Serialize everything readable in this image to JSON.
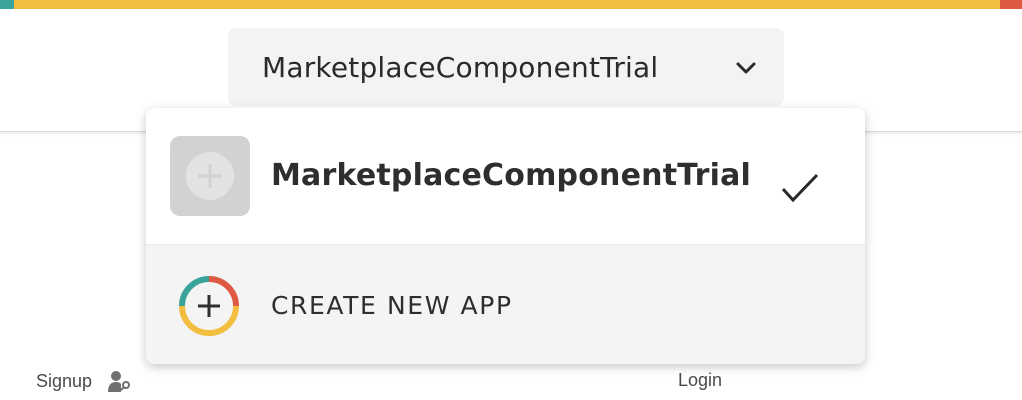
{
  "header": {
    "selected_app": "MarketplaceComponentTrial",
    "chevron_icon": "chevron-down-icon"
  },
  "dropdown": {
    "apps": [
      {
        "name": "MarketplaceComponentTrial",
        "thumbnail_icon": "plus-circle-icon",
        "selected": true,
        "selected_icon": "check-icon"
      }
    ],
    "create_new": {
      "label": "CREATE NEW APP",
      "icon": "multicolor-plus-circle-icon"
    }
  },
  "footer": {
    "signup_label": "Signup",
    "signup_icon": "user-key-icon",
    "login_label": "Login"
  },
  "colors": {
    "top_bar_teal": "#3aa39a",
    "top_bar_yellow": "#f3bd3f",
    "top_bar_red": "#df5a43",
    "selector_bg": "#f3f3f3",
    "create_item_bg": "#f4f4f4",
    "thumbnail_bg": "#d2d2d2"
  }
}
